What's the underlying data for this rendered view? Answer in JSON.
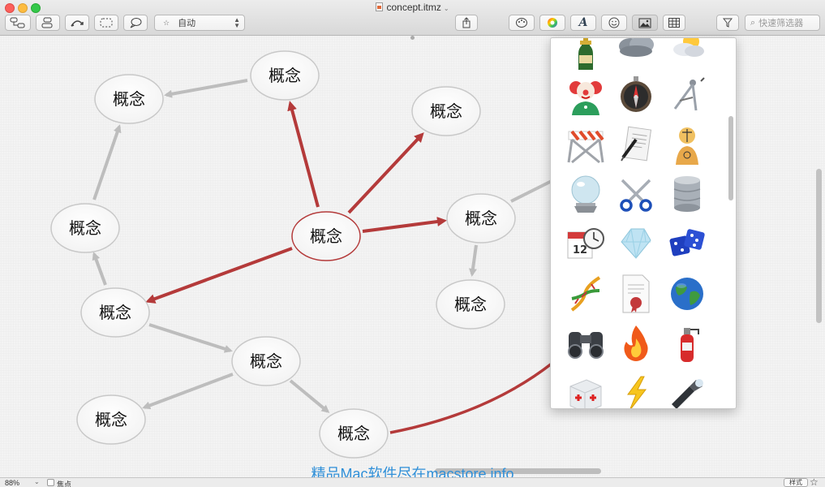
{
  "window": {
    "title": "concept.itmz"
  },
  "toolbar": {
    "style_select_value": "自动",
    "search_placeholder": "快速筛选器",
    "font_button_label": "A"
  },
  "map": {
    "center": {
      "label": "概念"
    },
    "nodes": [
      {
        "id": "top",
        "label": "概念"
      },
      {
        "id": "top-left",
        "label": "概念"
      },
      {
        "id": "top-right",
        "label": "概念"
      },
      {
        "id": "left",
        "label": "概念"
      },
      {
        "id": "right",
        "label": "概念"
      },
      {
        "id": "right-below",
        "label": "概念"
      },
      {
        "id": "lower-left",
        "label": "概念"
      },
      {
        "id": "bottom-mid",
        "label": "概念"
      },
      {
        "id": "bottom-left",
        "label": "概念"
      },
      {
        "id": "bottom",
        "label": "概念"
      }
    ]
  },
  "image_popover": {
    "icons": [
      "champagne-bottle-icon",
      "storm-cloud-icon",
      "sun-cloud-icon",
      "clown-icon",
      "compass-icon",
      "drawing-compass-icon",
      "road-barrier-icon",
      "contract-pen-icon",
      "crash-test-dummy-icon",
      "crystal-ball-icon",
      "scissors-icon",
      "database-icon",
      "calendar-clock-icon",
      "diamond-icon",
      "dice-icon",
      "dna-icon",
      "certificate-icon",
      "globe-icon",
      "binoculars-icon",
      "fire-icon",
      "fire-extinguisher-icon",
      "first-aid-kit-icon",
      "lightning-icon",
      "flashlight-icon"
    ]
  },
  "colors": {
    "accent_red": "#b43a3a",
    "link_gray": "#bdbdbd",
    "watermark": "#2f8fd8"
  },
  "watermark": "精品Mac软件尽在macstore.info",
  "statusbar": {
    "zoom": "88%",
    "focus_label": "焦点",
    "style_button": "样式"
  }
}
